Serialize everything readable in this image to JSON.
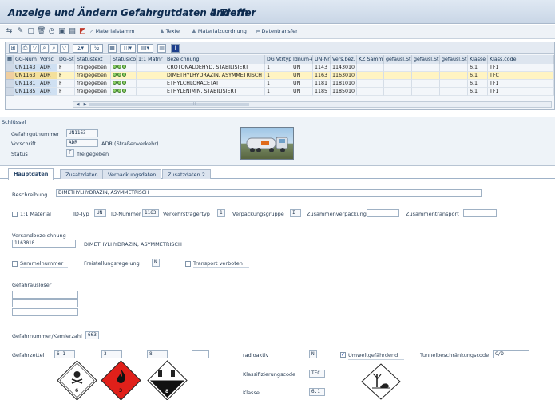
{
  "window": {
    "title": "Anzeige und Ändern Gefahrgutdaten ändern",
    "hits": "4 Treffer"
  },
  "toolbar": {
    "icons": [
      "back-icon",
      "edit-icon",
      "new-icon",
      "delete-icon",
      "history-icon",
      "save-icon",
      "info-icon",
      "help-icon"
    ],
    "materialstamm": "Materialstamm",
    "texte": "Texte",
    "materialzuordnung": "Materialzuordnung",
    "datentransfer": "Datentransfer"
  },
  "grid": {
    "toolbar_icons": [
      "detail-icon",
      "print-icon",
      "filter-icon",
      "find-icon",
      "find-next-icon",
      "sort-icon",
      "sum-icon",
      "subtotal-icon",
      "export-icon",
      "layout-icon",
      "graphic-icon",
      "info-icon"
    ],
    "columns": [
      "GG-Num",
      "Vorsc",
      "DG-Stat.",
      "Statustext",
      "Statusicon",
      "1:1 Matnr",
      "Bezeichnung",
      "DG Vtrtyp",
      "Idnum-kz",
      "UN-Nr.",
      "Vers.bez.",
      "KZ Sammel",
      "gefausl.St",
      "gefausl.St",
      "gefausl.St",
      "Klasse",
      "Klass.code"
    ],
    "rows": [
      [
        "UN1143",
        "ADR",
        "F",
        "freigegeben",
        "",
        "",
        "CROTONALDEHYD, STABILISIERT",
        "1",
        "UN",
        "1143",
        "1143010",
        "",
        "",
        "",
        "",
        "6.1",
        "TF1"
      ],
      [
        "UN1163",
        "ADR",
        "F",
        "freigegeben",
        "",
        "",
        "DIMETHYLHYDRAZIN, ASYMMETRISCH",
        "1",
        "UN",
        "1163",
        "1163010",
        "",
        "",
        "",
        "",
        "6.1",
        "TFC"
      ],
      [
        "UN1181",
        "ADR",
        "F",
        "freigegeben",
        "",
        "",
        "ETHYLCHLORACETAT",
        "1",
        "UN",
        "1181",
        "1181010",
        "",
        "",
        "",
        "",
        "6.1",
        "TF1"
      ],
      [
        "UN1185",
        "ADR",
        "F",
        "freigegeben",
        "",
        "",
        "ETHYLENIMIN, STABILISIERT",
        "1",
        "UN",
        "1185",
        "1185010",
        "",
        "",
        "",
        "",
        "6.1",
        "TF1"
      ]
    ],
    "selected_row": 1,
    "scroll_text": "III"
  },
  "key": {
    "title": "Schlüssel",
    "gg_label": "Gefahrgutnummer",
    "gg_value": "UN1163",
    "vorschrift_label": "Vorschrift",
    "vorschrift_value": "ADR",
    "vorschrift_text": "ADR (Straßenverkehr)",
    "status_label": "Status",
    "status_value": "F",
    "status_text": "freigegeben"
  },
  "tabs": [
    "Hauptdaten",
    "Zusatzdaten",
    "Verpackungsdaten",
    "Zusatzdaten 2"
  ],
  "main": {
    "beschreibung_label": "Beschreibung",
    "beschreibung_value": "DIMETHYLHYDRAZIN, ASYMMETRISCH",
    "mat11_label": "1:1 Material",
    "idtyp_label": "ID-Typ",
    "idtyp_value": "UN",
    "idnr_label": "ID-Nummer",
    "idnr_value": "1163",
    "vtt_label": "Verkehrsträgertyp",
    "vtt_value": "1",
    "vpg_label": "Verpackungsgruppe",
    "vpg_value": "I",
    "zusverp_label": "Zusammenverpackung",
    "zusverp_value": "",
    "zustrans_label": "Zusammentransport",
    "zustrans_value": "",
    "versbez_label": "Versandbezeichnung",
    "versbez_value": "1163010",
    "versbez_text": "DIMETHYLHYDRAZIN, ASYMMETRISCH",
    "sammel_label": "Sammelnummer",
    "frei_label": "Freistellungsregelung",
    "frei_value": "N",
    "transverb_label": "Transport verboten",
    "ausloeser_label": "Gefahrauslöser",
    "gefnr_label": "Gefahrnummer/Kemlerzahl",
    "gefnr_value": "663",
    "zettel_label": "Gefahrzettel",
    "zettel": [
      "6.1",
      "3",
      "8",
      ""
    ],
    "radio_label": "radioaktiv",
    "radio_value": "N",
    "umwelt_label": "Umweltgefährdend",
    "umwelt_check": "✓",
    "tunnel_label": "Tunnelbeschränkungscode",
    "tunnel_value": "C/D",
    "klasscode_label": "Klassifizierungscode",
    "klasscode_value": "TFC",
    "klasse_label": "Klasse",
    "klasse_value": "6.1"
  },
  "labels": {
    "l1": "6",
    "l2": "3",
    "l3": "8"
  }
}
